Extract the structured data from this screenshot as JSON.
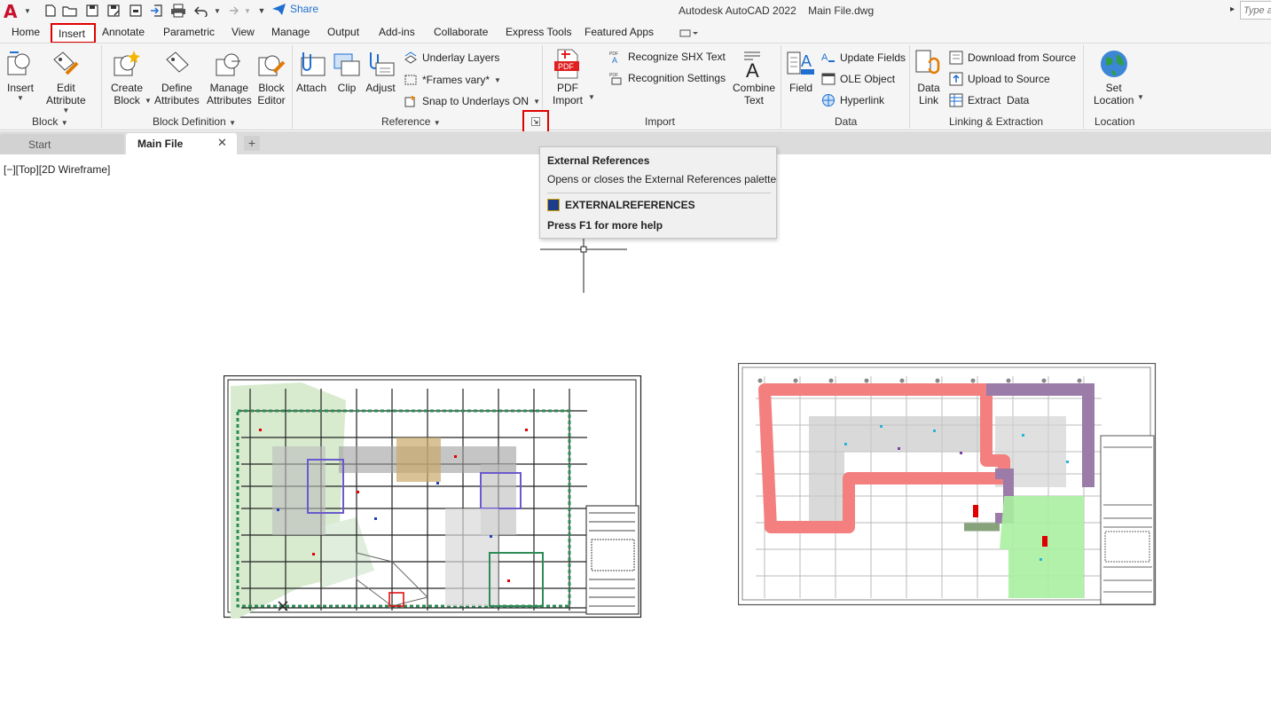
{
  "titlebar": {
    "app_logo": "A",
    "share": "Share",
    "window_title": "Autodesk AutoCAD 2022    Main File.dwg",
    "type_placeholder": "Type a",
    "icons": [
      "new-file-icon",
      "open-folder-icon",
      "save-icon",
      "save-as-icon",
      "import-icon",
      "print-icon",
      "undo-icon",
      "redo-icon"
    ]
  },
  "ribbon_tabs": [
    "Home",
    "Insert",
    "Annotate",
    "Parametric",
    "View",
    "Manage",
    "Output",
    "Add-ins",
    "Collaborate",
    "Express Tools",
    "Featured Apps"
  ],
  "active_tab": "Insert",
  "panels": {
    "block": {
      "title": "Block",
      "insert": "Insert",
      "edit_attribute": [
        "Edit",
        "Attribute"
      ]
    },
    "block_definition": {
      "title": "Block Definition",
      "create_block": [
        "Create",
        "Block"
      ],
      "define_attributes": [
        "Define",
        "Attributes"
      ],
      "manage_attributes": [
        "Manage",
        "Attributes"
      ],
      "block_editor": [
        "Block",
        "Editor"
      ]
    },
    "reference": {
      "title": "Reference",
      "attach": "Attach",
      "clip": "Clip",
      "adjust": "Adjust",
      "underlay_layers": "Underlay Layers",
      "frames_vary": "*Frames vary*",
      "snap_to_underlays": "Snap to Underlays ON"
    },
    "import": {
      "title": "Import",
      "pdf_import": [
        "PDF",
        "Import"
      ],
      "recognize_shx": "Recognize SHX Text",
      "recognition_settings": "Recognition Settings",
      "combine_text": [
        "Combine",
        "Text"
      ]
    },
    "data": {
      "title": "Data",
      "field": "Field",
      "update_fields": "Update Fields",
      "ole_object": "OLE Object",
      "hyperlink": "Hyperlink"
    },
    "linking": {
      "title": "Linking & Extraction",
      "data_link": [
        "Data",
        "Link"
      ],
      "download_from_source": "Download from Source",
      "upload_to_source": "Upload to Source",
      "extract_data": "Extract  Data"
    },
    "location": {
      "title": "Location",
      "set_location": [
        "Set",
        "Location"
      ]
    }
  },
  "file_tabs": {
    "start": "Start",
    "main": "Main File",
    "close": "✕",
    "add": "+"
  },
  "viewport_label": "[−][Top][2D Wireframe]",
  "tooltip": {
    "title": "External References",
    "description": "Opens or closes the External References palette",
    "command": "EXTERNALREFERENCES",
    "help": "Press F1 for more help"
  },
  "colors": {
    "accent_red": "#e00000",
    "ribbon_bg": "#f5f5f5",
    "share_blue": "#1f6fd1",
    "route_red": "#f47f7f",
    "route_purple": "#9b7ba7",
    "route_green": "#a9f0a0"
  }
}
